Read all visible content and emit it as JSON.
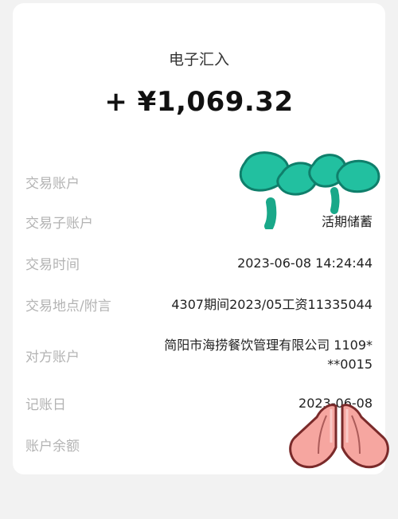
{
  "title": "电子汇入",
  "amount": "+ ¥1,069.32",
  "rows": [
    {
      "label": "交易账户",
      "value": ""
    },
    {
      "label": "交易子账户",
      "value": "活期储蓄"
    },
    {
      "label": "交易时间",
      "value": "2023-06-08 14:24:44"
    },
    {
      "label": "交易地点/附言",
      "value": "4307期间2023/05工资11335044"
    },
    {
      "label": "对方账户",
      "value": "简阳市海捞餐饮管理有限公司 1109*\n**0015"
    },
    {
      "label": "记账日",
      "value": "2023-06-08"
    },
    {
      "label": "账户余额",
      "value": ""
    }
  ],
  "stickers": {
    "sprout": "sprout-sticker",
    "hands": "praying-hands-sticker"
  },
  "colors": {
    "background": "#f2f2f2",
    "card": "#ffffff",
    "label": "#b3b3b3",
    "value": "#222222",
    "sprout": "#1fb89a",
    "hands": "#f6a6a0"
  }
}
